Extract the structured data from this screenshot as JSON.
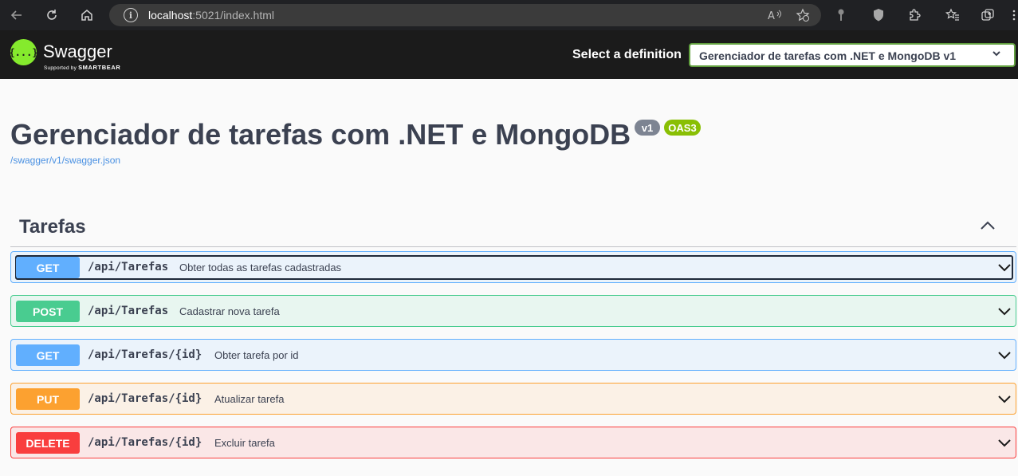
{
  "browser": {
    "url_host": "localhost",
    "url_rest": ":5021/index.html"
  },
  "topbar": {
    "logo_text": "Swagger",
    "logo_sub_prefix": "Supported by ",
    "logo_sub_brand": "SMARTBEAR",
    "definition_label": "Select a definition",
    "definition_selected": "Gerenciador de tarefas com .NET e MongoDB v1"
  },
  "info": {
    "title": "Gerenciador de tarefas com .NET e MongoDB",
    "version_badge": "v1",
    "oas_badge": "OAS3",
    "spec_link": "/swagger/v1/swagger.json"
  },
  "tag": {
    "name": "Tarefas"
  },
  "operations": [
    {
      "method": "GET",
      "path": "/api/Tarefas",
      "summary": "Obter todas as tarefas cadastradas"
    },
    {
      "method": "POST",
      "path": "/api/Tarefas",
      "summary": "Cadastrar nova tarefa"
    },
    {
      "method": "GET",
      "path": "/api/Tarefas/{id}",
      "summary": "Obter tarefa por id"
    },
    {
      "method": "PUT",
      "path": "/api/Tarefas/{id}",
      "summary": "Atualizar tarefa"
    },
    {
      "method": "DELETE",
      "path": "/api/Tarefas/{id}",
      "summary": "Excluir tarefa"
    }
  ],
  "colors": {
    "get": "#61affe",
    "post": "#49cc90",
    "put": "#fca130",
    "delete": "#f93e3e",
    "swagger_green": "#85ea2d"
  }
}
